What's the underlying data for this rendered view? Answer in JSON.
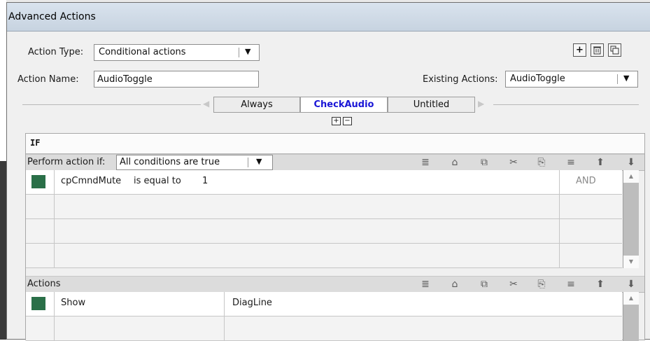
{
  "window": {
    "title": "Advanced Actions"
  },
  "header": {
    "action_type_label": "Action Type:",
    "action_type_value": "Conditional actions",
    "action_name_label": "Action Name:",
    "action_name_value": "AudioToggle",
    "existing_actions_label": "Existing Actions:",
    "existing_actions_value": "AudioToggle"
  },
  "tabs": [
    {
      "label": "Always"
    },
    {
      "label": "CheckAudio"
    },
    {
      "label": "Untitled"
    }
  ],
  "if_section": {
    "heading": "IF",
    "perform_label": "Perform action if:",
    "perform_value": "All conditions are true",
    "condition": {
      "variable": "cpCmndMute",
      "operator": "is equal to",
      "value": "1",
      "logic": "AND"
    }
  },
  "actions_section": {
    "heading": "Actions",
    "row": {
      "command": "Show",
      "target": "DiagLine"
    }
  },
  "colors": {
    "row_swatch": "#2a6f48",
    "selected_tab_text": "#1a16d6"
  }
}
